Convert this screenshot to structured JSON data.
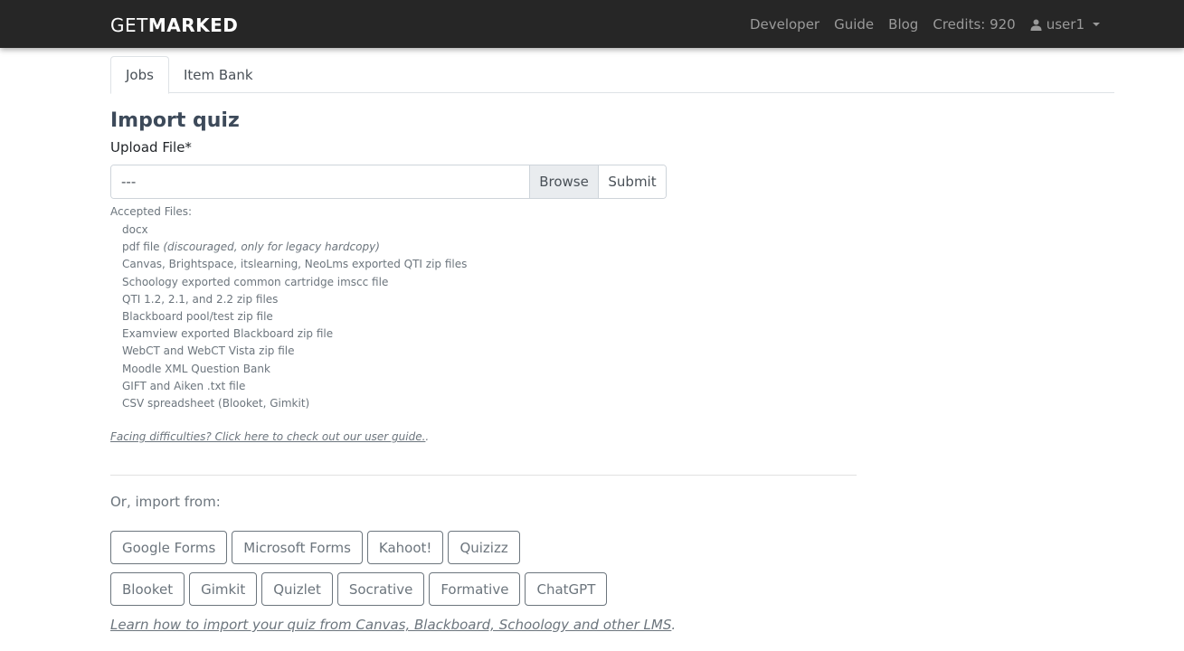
{
  "navbar": {
    "brand_light": "GET",
    "brand_bold": "MARKED",
    "links": [
      {
        "label": "Developer"
      },
      {
        "label": "Guide"
      },
      {
        "label": "Blog"
      }
    ],
    "credits": "Credits: 920",
    "user": "user1",
    "user_icon": "user-icon"
  },
  "tabs": [
    {
      "label": "Jobs",
      "active": true
    },
    {
      "label": "Item Bank",
      "active": false
    }
  ],
  "main": {
    "title": "Import quiz",
    "upload_label": "Upload File*",
    "file_input_value": "---",
    "browse_label": "Browse",
    "submit_label": "Submit",
    "accepted_title": "Accepted Files:",
    "accepted_files": [
      {
        "text": "docx",
        "note": ""
      },
      {
        "text": "pdf file ",
        "note": "(discouraged, only for legacy hardcopy)"
      },
      {
        "text": "Canvas, Brightspace, itslearning, NeoLms exported QTI zip files",
        "note": ""
      },
      {
        "text": "Schoology exported common cartridge imscc file",
        "note": ""
      },
      {
        "text": "QTI 1.2, 2.1, and 2.2 zip files",
        "note": ""
      },
      {
        "text": "Blackboard pool/test zip file",
        "note": ""
      },
      {
        "text": "Examview exported Blackboard zip file",
        "note": ""
      },
      {
        "text": "WebCT and WebCT Vista zip file",
        "note": ""
      },
      {
        "text": "Moodle XML Question Bank",
        "note": ""
      },
      {
        "text": "GIFT and Aiken .txt file",
        "note": ""
      },
      {
        "text": "CSV spreadsheet (Blooket, Gimkit)",
        "note": ""
      }
    ],
    "help_link": "Facing difficulties? Click here to check out our user guide.",
    "help_suffix": ".",
    "or_import": "Or, import from:",
    "sources_row1": [
      "Google Forms",
      "Microsoft Forms",
      "Kahoot!",
      "Quizizz"
    ],
    "sources_row2": [
      "Blooket",
      "Gimkit",
      "Quizlet",
      "Socrative",
      "Formative",
      "ChatGPT"
    ],
    "lms_link": "Learn how to import your quiz from Canvas, Blackboard, Schoology and other LMS",
    "lms_suffix": "."
  },
  "colors": {
    "navbar_bg": "#262626",
    "nav_text": "#9a9a9a",
    "title": "#3d4a5a",
    "muted": "#6c757d"
  }
}
